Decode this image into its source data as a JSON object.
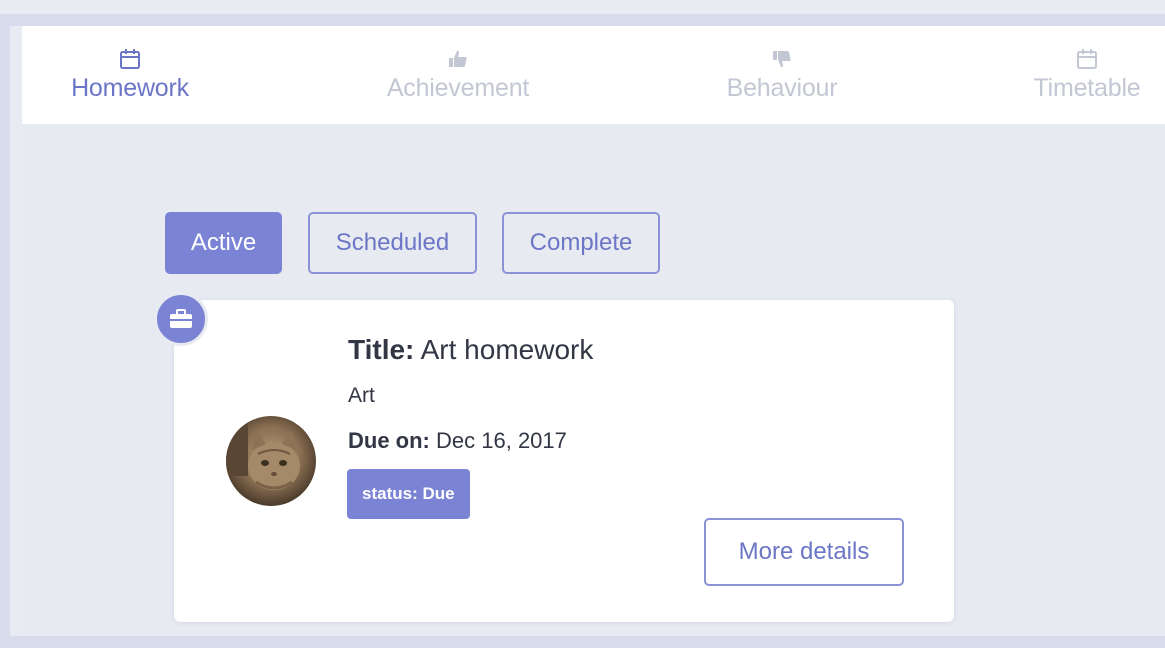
{
  "tabs": [
    {
      "label": "Homework",
      "icon": "calendar-icon",
      "active": true
    },
    {
      "label": "Achievement",
      "icon": "thumbs-up-icon",
      "active": false
    },
    {
      "label": "Behaviour",
      "icon": "thumbs-down-icon",
      "active": false
    },
    {
      "label": "Timetable",
      "icon": "calendar-icon",
      "active": false
    }
  ],
  "filters": [
    {
      "label": "Active",
      "active": true
    },
    {
      "label": "Scheduled",
      "active": false
    },
    {
      "label": "Complete",
      "active": false
    }
  ],
  "homework": {
    "badge_icon": "briefcase-icon",
    "avatar": "cat-avatar",
    "title_label": "Title:",
    "title_value": "Art homework",
    "subject": "Art",
    "due_label": "Due on:",
    "due_value": "Dec 16, 2017",
    "status": "status: Due",
    "more_details_label": "More details"
  },
  "colors": {
    "accent": "#7b83d5",
    "active_text": "#6c76c6",
    "inactive_text": "#c3c7d3",
    "background": "#e8eaf2"
  }
}
